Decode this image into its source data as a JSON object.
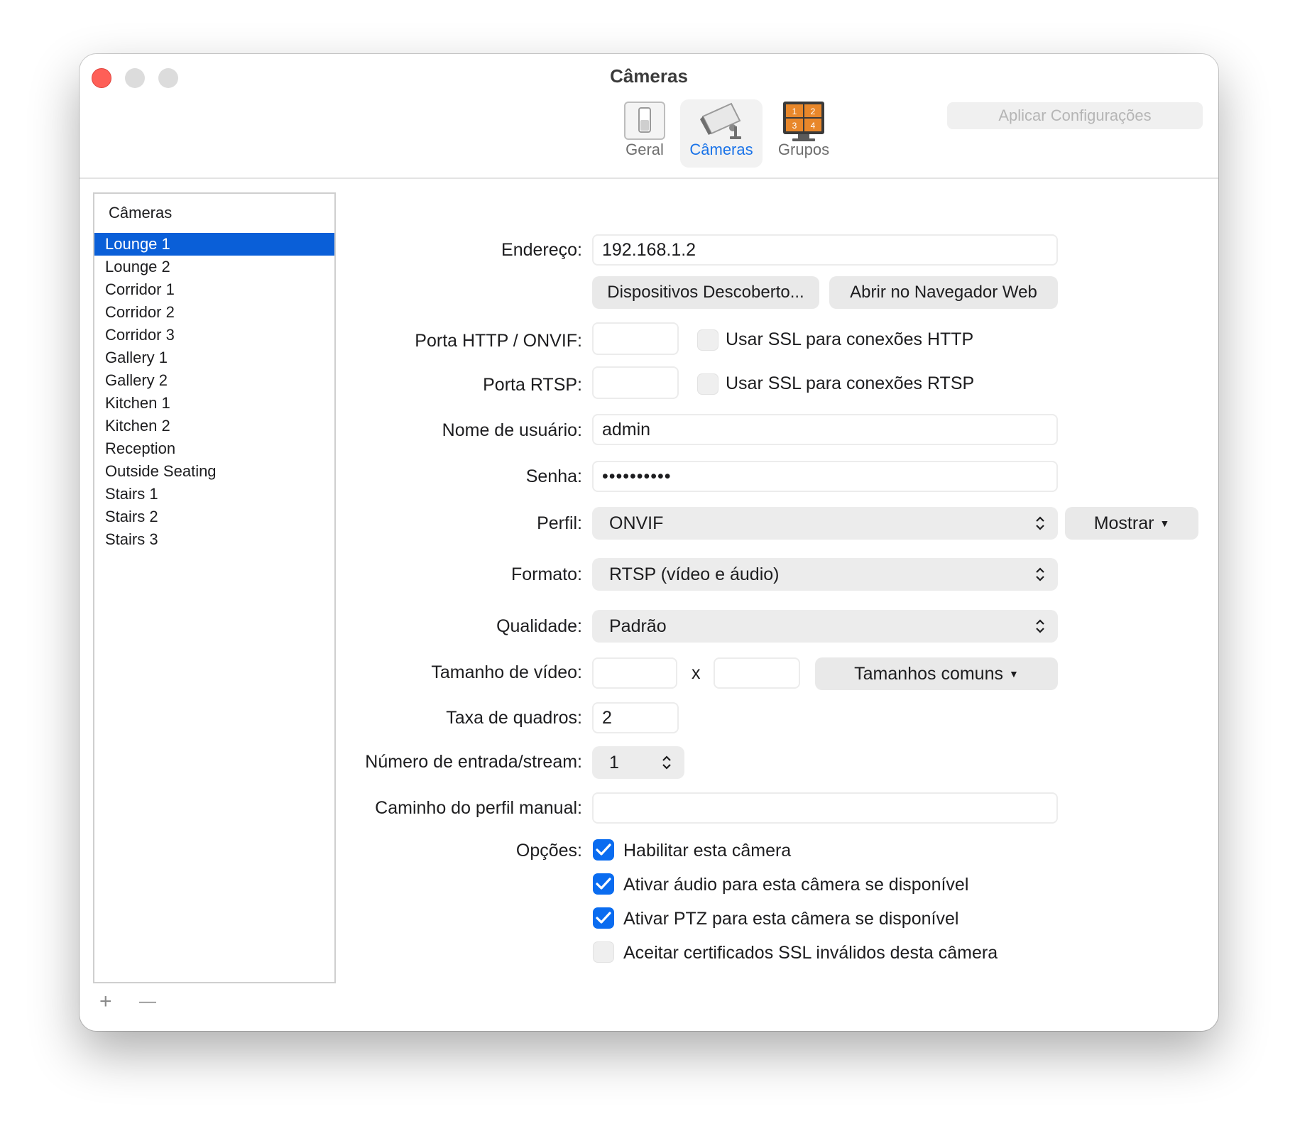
{
  "window": {
    "title": "Câmeras"
  },
  "toolbar": {
    "items": [
      {
        "label": "Geral",
        "icon": "switch-icon"
      },
      {
        "label": "Câmeras",
        "icon": "security-camera-icon",
        "selected": true
      },
      {
        "label": "Grupos",
        "icon": "monitor-grid-icon",
        "grid_numbers": [
          "1",
          "2",
          "3",
          "4"
        ]
      }
    ],
    "apply_label": "Aplicar Configurações"
  },
  "sidebar": {
    "header": "Câmeras",
    "items": [
      "Lounge 1",
      "Lounge 2",
      "Corridor 1",
      "Corridor 2",
      "Corridor 3",
      "Gallery 1",
      "Gallery 2",
      "Kitchen 1",
      "Kitchen 2",
      "Reception",
      "Outside Seating",
      "Stairs 1",
      "Stairs 2",
      "Stairs 3"
    ],
    "selected_index": 0,
    "add_label": "+",
    "remove_label": "—"
  },
  "form": {
    "address_label": "Endereço:",
    "address_value": "192.168.1.2",
    "discovered_button": "Dispositivos Descoberto...",
    "open_browser_button": "Abrir no Navegador Web",
    "http_port_label": "Porta HTTP / ONVIF:",
    "http_port_value": "",
    "http_ssl_label": "Usar SSL para conexões HTTP",
    "http_ssl_checked": false,
    "rtsp_port_label": "Porta RTSP:",
    "rtsp_port_value": "",
    "rtsp_ssl_label": "Usar SSL para conexões RTSP",
    "rtsp_ssl_checked": false,
    "username_label": "Nome de usuário:",
    "username_value": "admin",
    "password_label": "Senha:",
    "password_value": "••••••••••",
    "profile_label": "Perfil:",
    "profile_value": "ONVIF",
    "show_button": "Mostrar",
    "format_label": "Formato:",
    "format_value": "RTSP (vídeo e áudio)",
    "quality_label": "Qualidade:",
    "quality_value": "Padrão",
    "video_size_label": "Tamanho de vídeo:",
    "video_width": "",
    "video_size_separator": "x",
    "video_height": "",
    "common_sizes_button": "Tamanhos comuns",
    "framerate_label": "Taxa de quadros:",
    "framerate_value": "2",
    "stream_label": "Número de entrada/stream:",
    "stream_value": "1",
    "manual_path_label": "Caminho do perfil manual:",
    "manual_path_value": "",
    "options_label": "Opções:",
    "options": [
      {
        "label": "Habilitar esta câmera",
        "checked": true
      },
      {
        "label": "Ativar áudio para esta câmera se disponível",
        "checked": true
      },
      {
        "label": "Ativar PTZ para esta câmera se disponível",
        "checked": true
      },
      {
        "label": "Aceitar certificados SSL inválidos desta câmera",
        "checked": false
      }
    ]
  },
  "colors": {
    "accent": "#0a6cf0",
    "selection": "#0a5fd8",
    "close": "#fe5f57",
    "grupos_orange": "#e8872a"
  }
}
